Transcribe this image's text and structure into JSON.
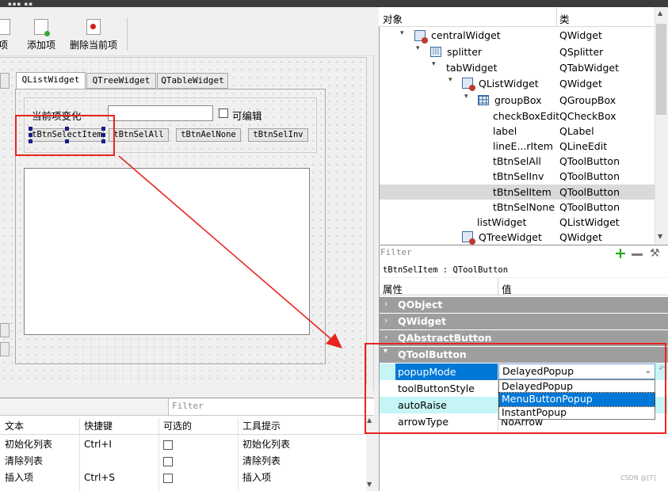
{
  "toolbar": {
    "items": [
      {
        "label": "项",
        "icon": "page-icon"
      },
      {
        "label": "添加项",
        "icon": "add-page-icon"
      },
      {
        "label": "删除当前项",
        "icon": "record-icon"
      }
    ]
  },
  "form": {
    "tabs": [
      "QListWidget",
      "QTreeWidget",
      "QTableWidget"
    ],
    "current_item_label": "当前项变化",
    "current_item_value": "",
    "editable_label": "可编辑",
    "editable_checked": false,
    "buttons": [
      "tBtnSelectItem",
      "tBtnSelAll",
      "tBtnAelNone",
      "tBtnSelInv"
    ]
  },
  "action_editor": {
    "filter_placeholder": "Filter",
    "columns": [
      "文本",
      "快捷键",
      "可选的",
      "工具提示"
    ],
    "rows": [
      {
        "text": "初始化列表",
        "shortcut": "Ctrl+I",
        "checkable": false,
        "tooltip": "初始化列表"
      },
      {
        "text": "清除列表",
        "shortcut": "",
        "checkable": false,
        "tooltip": "清除列表"
      },
      {
        "text": "插入项",
        "shortcut": "Ctrl+S",
        "checkable": false,
        "tooltip": "插入项"
      }
    ]
  },
  "object_inspector": {
    "col_object": "对象",
    "col_class": "类",
    "rows": [
      {
        "name": "centralWidget",
        "cls": "QWidget",
        "icon": "widget-icon",
        "arrow": "chevron-down-icon"
      },
      {
        "name": "splitter",
        "cls": "QSplitter",
        "icon": "splitter-icon",
        "arrow": "chevron-down-icon"
      },
      {
        "name": "tabWidget",
        "cls": "QTabWidget",
        "icon": "",
        "arrow": "chevron-down-icon"
      },
      {
        "name": "QListWidget",
        "cls": "QWidget",
        "icon": "widget-icon",
        "arrow": "chevron-down-icon"
      },
      {
        "name": "groupBox",
        "cls": "QGroupBox",
        "icon": "grid-icon",
        "arrow": "chevron-down-icon"
      },
      {
        "name": "checkBoxEdit",
        "cls": "QCheckBox",
        "icon": "",
        "arrow": ""
      },
      {
        "name": "label",
        "cls": "QLabel",
        "icon": "",
        "arrow": ""
      },
      {
        "name": "lineE...rItem",
        "cls": "QLineEdit",
        "icon": "",
        "arrow": ""
      },
      {
        "name": "tBtnSelAll",
        "cls": "QToolButton",
        "icon": "",
        "arrow": ""
      },
      {
        "name": "tBtnSelInv",
        "cls": "QToolButton",
        "icon": "",
        "arrow": ""
      },
      {
        "name": "tBtnSelItem",
        "cls": "QToolButton",
        "icon": "",
        "arrow": "",
        "selected": true
      },
      {
        "name": "tBtnSelNone",
        "cls": "QToolButton",
        "icon": "",
        "arrow": ""
      },
      {
        "name": "listWidget",
        "cls": "QListWidget",
        "icon": "",
        "arrow": ""
      },
      {
        "name": "QTreeWidget",
        "cls": "QWidget",
        "icon": "widget-icon",
        "arrow": ""
      }
    ]
  },
  "property_editor": {
    "filter_placeholder": "Filter",
    "class_label": "tBtnSelItem : QToolButton",
    "col_property": "属性",
    "col_value": "值",
    "groups": [
      "QObject",
      "QWidget",
      "QAbstractButton",
      "QToolButton"
    ],
    "properties": [
      {
        "name": "popupMode",
        "value": "DelayedPopup"
      },
      {
        "name": "toolButtonStyle",
        "value": ""
      },
      {
        "name": "autoRaise",
        "value": ""
      },
      {
        "name": "arrowType",
        "value": "NoArrow"
      }
    ],
    "dropdown_options": [
      "DelayedPopup",
      "MenuButtonPopup",
      "InstantPopup"
    ],
    "dropdown_highlighted": "MenuButtonPopup"
  },
  "watermark": "CSDN @[T]",
  "colors": {
    "annotation_red": "#e8241e",
    "selection_blue": "#0078d7",
    "property_cyan": "#c6f5f5",
    "group_gray": "#9e9e9e",
    "add_green": "#22a822"
  }
}
